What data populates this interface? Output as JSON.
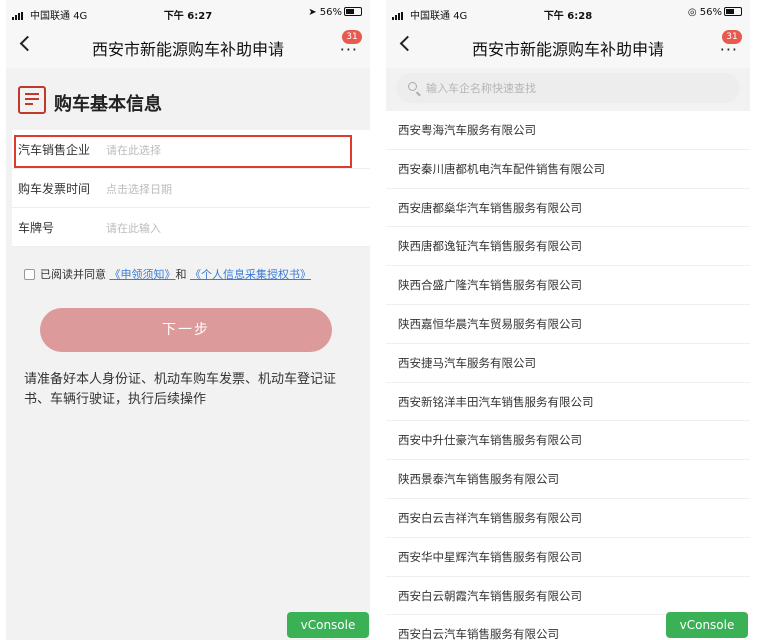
{
  "status_left": {
    "carrier": "中国联通",
    "network": "4G",
    "time": "下午 6:27",
    "battery": "56%"
  },
  "status_right": {
    "carrier": "中国联通",
    "network": "4G",
    "time": "下午 6:28",
    "battery": "56%"
  },
  "nav": {
    "title": "西安市新能源购车补助申请",
    "more": "···",
    "badge": "31"
  },
  "form_screen": {
    "section_title": "购车基本信息",
    "fields": [
      {
        "label": "汽车销售企业",
        "placeholder": "请在此选择"
      },
      {
        "label": "购车发票时间",
        "placeholder": "点击选择日期"
      },
      {
        "label": "车牌号",
        "placeholder": "请在此输入"
      }
    ],
    "agree_text": "已阅读并同意",
    "link1": "《申领须知》",
    "and_text": "和",
    "link2": "《个人信息采集授权书》",
    "next_button": "下一步",
    "tip": "请准备好本人身份证、机动车购车发票、机动车登记证书、车辆行驶证，执行后续操作"
  },
  "list_screen": {
    "search_placeholder": "输入车企名称快速查找",
    "companies": [
      "西安粤海汽车服务有限公司",
      "西安秦川唐都机电汽车配件销售有限公司",
      "西安唐都燊华汽车销售服务有限公司",
      "陕西唐都逸钲汽车销售服务有限公司",
      "陕西合盛广隆汽车销售服务有限公司",
      "陕西嘉恒华晨汽车贸易服务有限公司",
      "西安捷马汽车服务有限公司",
      "西安新铭洋丰田汽车销售服务有限公司",
      "西安中升仕豪汽车销售服务有限公司",
      "陕西景泰汽车销售服务有限公司",
      "西安白云吉祥汽车销售服务有限公司",
      "西安华中星辉汽车销售服务有限公司",
      "西安白云朝霞汽车销售服务有限公司",
      "西安白云汽车销售服务有限公司"
    ]
  },
  "vconsole_label": "vConsole",
  "colors": {
    "accent_red": "#e03a30",
    "button_pink": "#dc9a9a",
    "link_blue": "#3a7bd5",
    "vconsole_green": "#3bb156",
    "badge_red": "#e65a4f"
  }
}
